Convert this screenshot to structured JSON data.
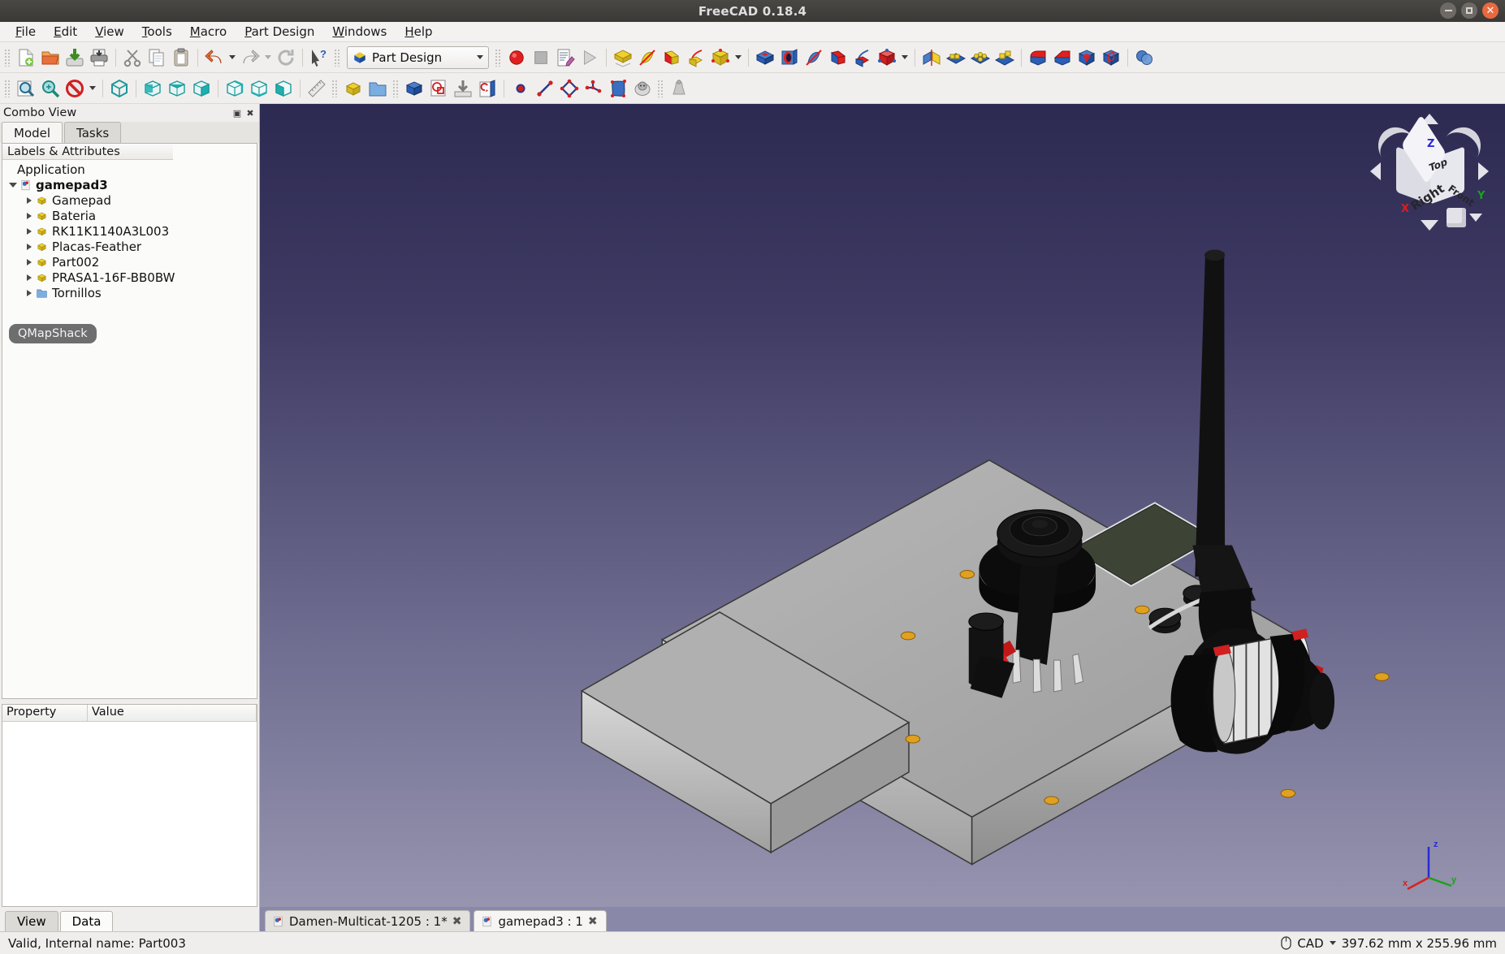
{
  "window": {
    "title": "FreeCAD 0.18.4",
    "controls": [
      {
        "name": "minimize",
        "glyph": "–"
      },
      {
        "name": "maximize",
        "glyph": "□"
      },
      {
        "name": "close",
        "glyph": "✕"
      }
    ]
  },
  "menubar": [
    {
      "label": "File",
      "accel": "F"
    },
    {
      "label": "Edit",
      "accel": "E"
    },
    {
      "label": "View",
      "accel": "V"
    },
    {
      "label": "Tools",
      "accel": "T"
    },
    {
      "label": "Macro",
      "accel": "M"
    },
    {
      "label": "Part Design",
      "accel": "P"
    },
    {
      "label": "Windows",
      "accel": "W"
    },
    {
      "label": "Help",
      "accel": "H"
    }
  ],
  "toolbar_file": [
    {
      "icon": "new-document-icon",
      "label": "New"
    },
    {
      "icon": "open-folder-icon",
      "label": "Open"
    },
    {
      "icon": "save-icon",
      "label": "Save"
    },
    {
      "icon": "print-icon",
      "label": "Print"
    },
    {
      "icon": "cut-scissors-icon",
      "label": "Cut"
    },
    {
      "icon": "copy-icon",
      "label": "Copy"
    },
    {
      "icon": "paste-icon",
      "label": "Paste"
    },
    {
      "icon": "undo-arrow-icon",
      "label": "Undo"
    },
    {
      "icon": "redo-arrow-icon",
      "label": "Redo"
    },
    {
      "icon": "refresh-icon",
      "label": "Refresh"
    },
    {
      "icon": "whats-this-icon",
      "label": "What's This"
    }
  ],
  "workbench": {
    "selected": "Part Design",
    "icon": "part-design-icon"
  },
  "toolbar_macro": [
    {
      "icon": "macro-record-icon",
      "label": "Macro recording"
    },
    {
      "icon": "macro-stop-icon",
      "label": "Stop macro recording"
    },
    {
      "icon": "macro-edit-icon",
      "label": "Macros"
    },
    {
      "icon": "macro-execute-icon",
      "label": "Execute macro"
    }
  ],
  "toolbar_partdesign_additive": [
    {
      "icon": "pad-icon",
      "label": "Pad"
    },
    {
      "icon": "revolution-icon",
      "label": "Revolution"
    },
    {
      "icon": "additive-loft-icon",
      "label": "Additive loft"
    },
    {
      "icon": "additive-pipe-icon",
      "label": "Additive pipe"
    },
    {
      "icon": "additive-primitive-icon",
      "label": "Additive primitive"
    }
  ],
  "toolbar_partdesign_subtractive": [
    {
      "icon": "pocket-icon",
      "label": "Pocket"
    },
    {
      "icon": "hole-icon",
      "label": "Hole"
    },
    {
      "icon": "groove-icon",
      "label": "Groove"
    },
    {
      "icon": "subtractive-loft-icon",
      "label": "Subtractive loft"
    },
    {
      "icon": "subtractive-pipe-icon",
      "label": "Subtractive pipe"
    },
    {
      "icon": "subtractive-primitive-icon",
      "label": "Subtractive primitive"
    }
  ],
  "toolbar_partdesign_transform": [
    {
      "icon": "mirrored-icon",
      "label": "Mirrored"
    },
    {
      "icon": "linear-pattern-icon",
      "label": "LinearPattern"
    },
    {
      "icon": "polar-pattern-icon",
      "label": "PolarPattern"
    },
    {
      "icon": "multi-transform-icon",
      "label": "Create MultiTransform"
    }
  ],
  "toolbar_partdesign_dressup": [
    {
      "icon": "fillet-icon",
      "label": "Fillet"
    },
    {
      "icon": "chamfer-icon",
      "label": "Chamfer"
    },
    {
      "icon": "draft-icon",
      "label": "Draft"
    },
    {
      "icon": "thickness-icon",
      "label": "Thickness"
    },
    {
      "icon": "boolean-icon",
      "label": "Boolean operation"
    }
  ],
  "toolbar_view": [
    {
      "icon": "fit-all-icon",
      "label": "Fit all"
    },
    {
      "icon": "fit-selection-icon",
      "label": "Fit selection"
    },
    {
      "icon": "draw-style-icon",
      "label": "Draw style"
    },
    {
      "icon": "axonometric-icon",
      "label": "Axonometric"
    },
    {
      "icon": "front-view-icon",
      "label": "Front"
    },
    {
      "icon": "top-view-icon",
      "label": "Top"
    },
    {
      "icon": "right-view-icon",
      "label": "Right"
    },
    {
      "icon": "rear-view-icon",
      "label": "Rear"
    },
    {
      "icon": "bottom-view-icon",
      "label": "Bottom"
    },
    {
      "icon": "left-view-icon",
      "label": "Left"
    },
    {
      "icon": "measure-icon",
      "label": "Measure"
    }
  ],
  "toolbar_structure": [
    {
      "icon": "create-part-icon",
      "label": "Create part"
    },
    {
      "icon": "create-group-icon",
      "label": "Create group"
    },
    {
      "icon": "create-body-icon",
      "label": "Create body"
    },
    {
      "icon": "create-sketch-icon",
      "label": "Create sketch"
    },
    {
      "icon": "attach-sketch-icon",
      "label": "Attach sketch"
    },
    {
      "icon": "validate-sketch-icon",
      "label": "Validate sketch"
    }
  ],
  "toolbar_sketcher": [
    {
      "icon": "create-point-icon",
      "label": "Create point"
    },
    {
      "icon": "create-line-icon",
      "label": "Create line"
    },
    {
      "icon": "create-polyline-icon",
      "label": "Create polyline"
    },
    {
      "icon": "create-datum-icon",
      "label": "Create datum"
    },
    {
      "icon": "shape-binder-icon",
      "label": "Create a sub-object shape binder"
    },
    {
      "icon": "clone-sheep-icon",
      "label": "Create a clone"
    },
    {
      "icon": "dressup-gray-icon",
      "label": "Apply a dress-up feature"
    }
  ],
  "combo_view": {
    "title": "Combo View",
    "float_button": "float-icon",
    "close_button": "close-icon",
    "tabs": [
      {
        "label": "Model",
        "active": true
      },
      {
        "label": "Tasks",
        "active": false
      }
    ],
    "tree_header": "Labels & Attributes",
    "tree": [
      {
        "label": "Application",
        "indent": 0,
        "arrow": "none",
        "icon": "none",
        "bold": false
      },
      {
        "label": "gamepad3",
        "indent": 1,
        "arrow": "open",
        "icon": "document-icon",
        "bold": true
      },
      {
        "label": "Gamepad",
        "indent": 2,
        "arrow": "closed",
        "icon": "part-icon",
        "bold": false
      },
      {
        "label": "Bateria",
        "indent": 2,
        "arrow": "closed",
        "icon": "part-icon",
        "bold": false
      },
      {
        "label": "RK11K1140A3L003",
        "indent": 2,
        "arrow": "closed",
        "icon": "part-icon",
        "bold": false
      },
      {
        "label": "Placas-Feather",
        "indent": 2,
        "arrow": "closed",
        "icon": "part-icon",
        "bold": false
      },
      {
        "label": "Part002",
        "indent": 2,
        "arrow": "closed",
        "icon": "part-icon",
        "bold": false
      },
      {
        "label": "PRASA1-16F-BB0BW",
        "indent": 2,
        "arrow": "closed",
        "icon": "part-icon",
        "bold": false
      },
      {
        "label": "Tornillos",
        "indent": 2,
        "arrow": "closed",
        "icon": "folder-icon",
        "bold": false
      }
    ],
    "overlay_pill": "QMapShack",
    "property_columns": [
      "Property",
      "Value"
    ],
    "bottom_tabs": [
      {
        "label": "View",
        "active": false
      },
      {
        "label": "Data",
        "active": true
      }
    ]
  },
  "view3d": {
    "navcube": {
      "face_top": "Top",
      "face_right": "Right",
      "face_front": "Front",
      "axis_z": "Z",
      "axis_y": "Y",
      "axis_x": "X"
    },
    "origin_axes": {
      "x": "x",
      "y": "y",
      "z": "z"
    },
    "document_tabs": [
      {
        "label": "Damen-Multicat-1205 : 1*",
        "active": false,
        "close": "✖"
      },
      {
        "label": "gamepad3 : 1",
        "active": true,
        "close": "✖"
      }
    ]
  },
  "statusbar": {
    "message": "Valid, Internal name: Part003",
    "nav_style": "CAD",
    "dimensions": "397.62 mm x 255.96 mm"
  },
  "colors": {
    "accent_blue": "#3465a4",
    "view_bg_top": "#2d2a52",
    "view_bg_bottom": "#9a98b2",
    "panel_bg": "#efeeec",
    "title_bg": "#3b3936",
    "close_btn": "#e9693f",
    "part_yellow": "#e0c030",
    "folder_blue": "#7baee0"
  }
}
